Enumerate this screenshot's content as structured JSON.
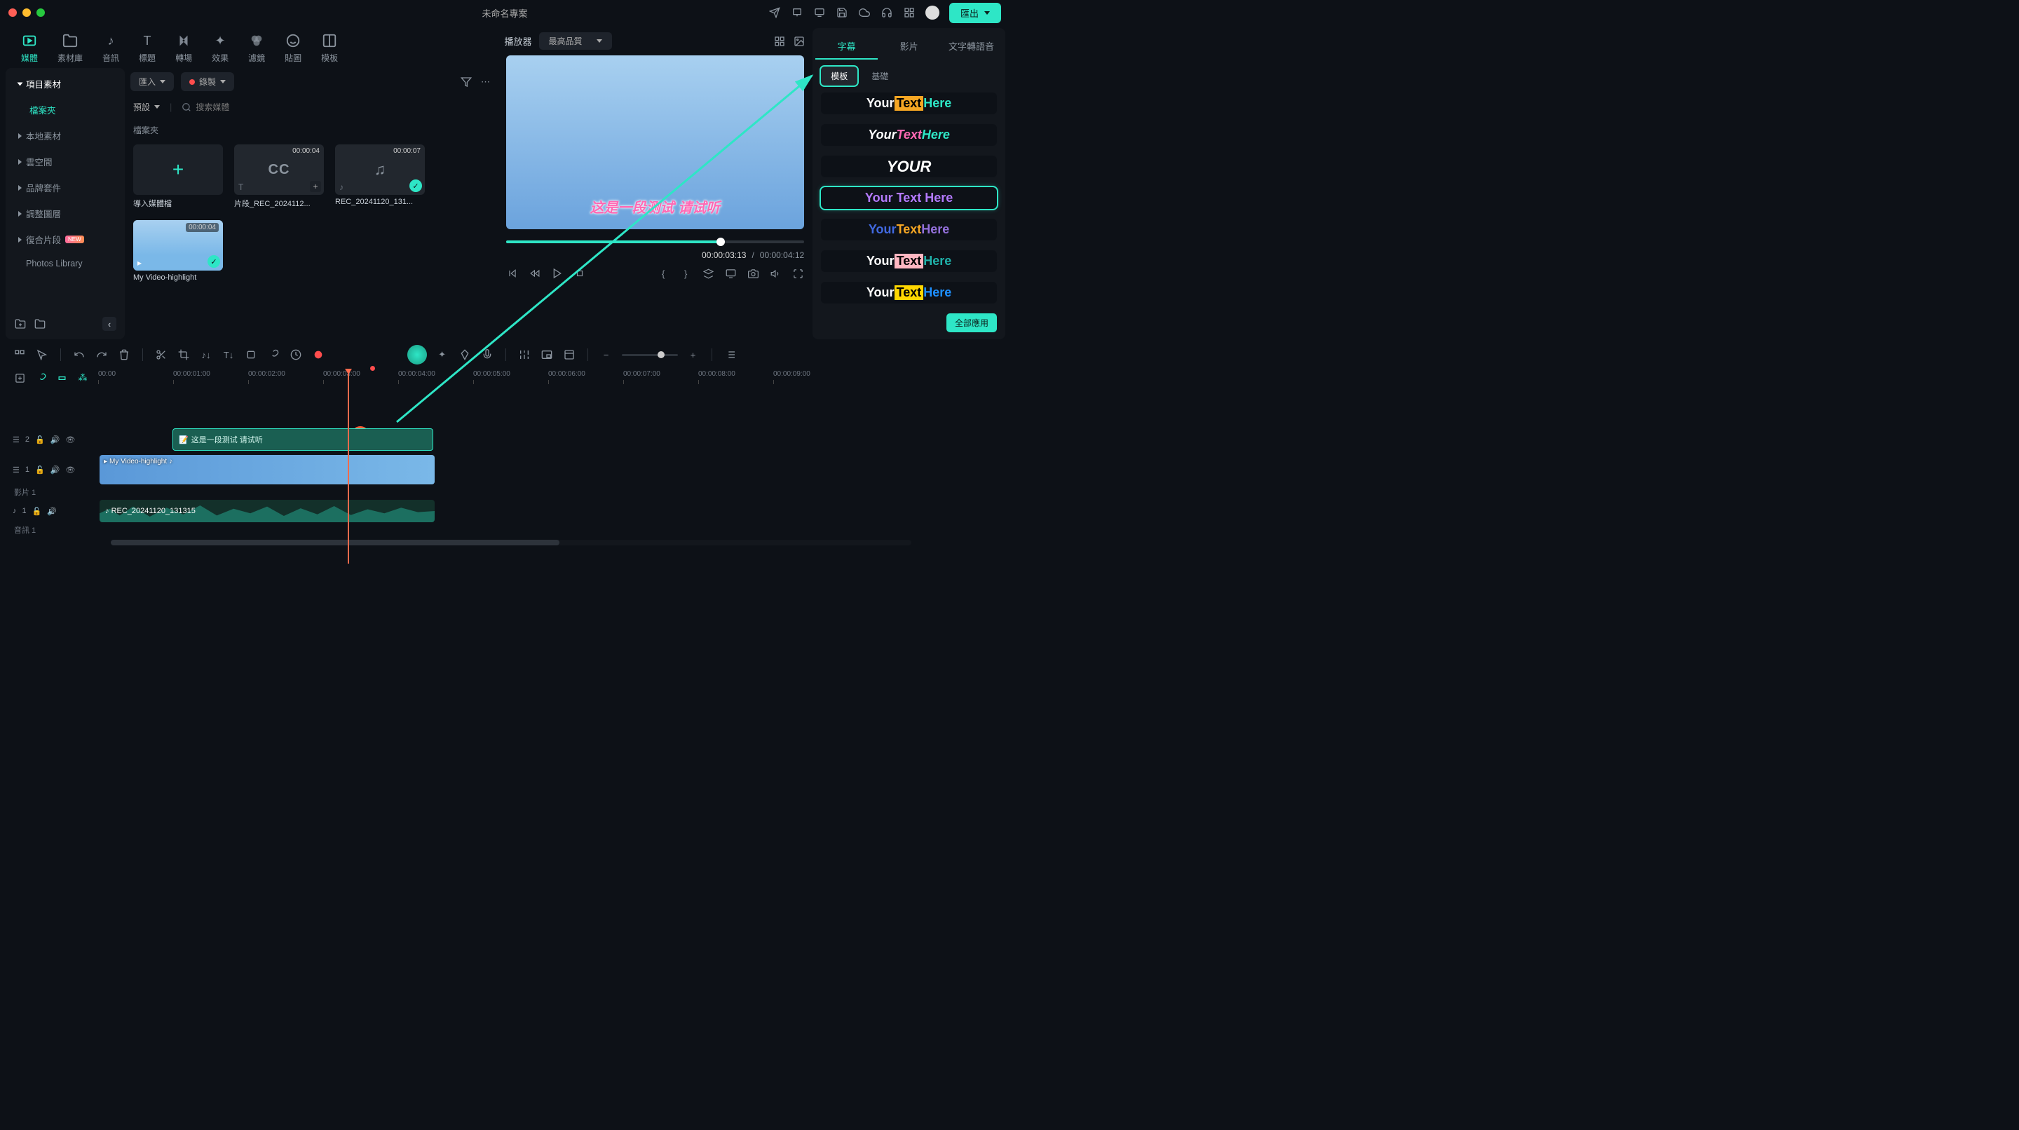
{
  "window": {
    "title": "未命名專案"
  },
  "titlebar": {
    "export": "匯出"
  },
  "tabs": {
    "media": "媒體",
    "stock": "素材庫",
    "audio": "音訊",
    "title": "標題",
    "transition": "轉場",
    "effect": "效果",
    "filter": "濾鏡",
    "sticker": "貼圖",
    "template": "模板"
  },
  "sidebar": {
    "project": "項目素材",
    "folder": "檔案夾",
    "local": "本地素材",
    "cloud": "雲空間",
    "brand": "品牌套件",
    "adjust": "調整圖層",
    "compound": "復合片段",
    "new": "NEW",
    "photos": "Photos Library"
  },
  "browser": {
    "import": "匯入",
    "record": "錄製",
    "preset": "預設",
    "search_ph": "搜索媒體",
    "folder_label": "檔案夾",
    "thumbs": {
      "add": "導入媒體檔",
      "cc": {
        "dur": "00:00:04",
        "label": "片段_REC_2024112..."
      },
      "audio": {
        "dur": "00:00:07",
        "label": "REC_20241120_131..."
      },
      "video": {
        "dur": "00:00:04",
        "label": "My Video-highlight"
      }
    }
  },
  "preview": {
    "header": "播放器",
    "quality": "最高品質",
    "subtitle": "这是一段测试 请试听",
    "cur": "00:00:03:13",
    "total": "00:00:04:12"
  },
  "right": {
    "t_subtitle": "字幕",
    "t_video": "影片",
    "t_tts": "文字轉語音",
    "sub_template": "模板",
    "sub_basic": "基礎",
    "apply_all": "全部應用",
    "tmpl_text": {
      "p1": "Your",
      "p2": "Text",
      "p3": "Here",
      "single": "YOUR",
      "long": "Your Text Here"
    }
  },
  "timeline": {
    "ticks": [
      "00:00",
      "00:00:01:00",
      "00:00:02:00",
      "00:00:03:00",
      "00:00:04:00",
      "00:00:05:00",
      "00:00:06:00",
      "00:00:07:00",
      "00:00:08:00",
      "00:00:09:00"
    ],
    "sub_track": "这是一段测试 请试听",
    "video_clip": "My Video-highlight",
    "audio_clip": "REC_20241120_131315",
    "t2": "2",
    "t1": "1",
    "a1": "1",
    "vlabel": "影片 1",
    "alabel": "音訊 1"
  }
}
